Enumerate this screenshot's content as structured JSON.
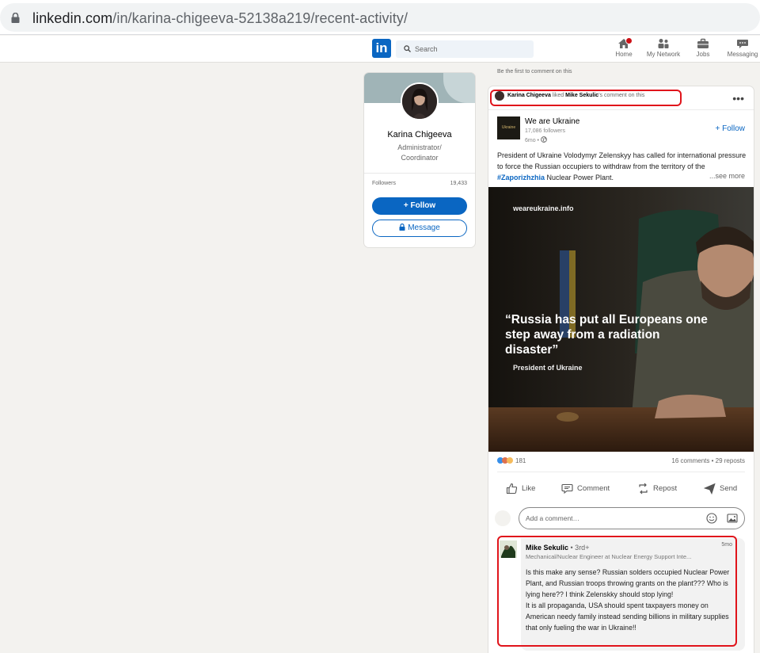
{
  "browser": {
    "url_host": "linkedin.com",
    "url_path": "/in/karina-chigeeva-52138a219/recent-activity/"
  },
  "nav": {
    "search_placeholder": "Search",
    "items": [
      {
        "label": "Home",
        "icon": "home-icon"
      },
      {
        "label": "My Network",
        "icon": "network-icon"
      },
      {
        "label": "Jobs",
        "icon": "briefcase-icon"
      },
      {
        "label": "Messaging",
        "icon": "messaging-icon"
      }
    ],
    "logo_text": "in"
  },
  "profile": {
    "name": "Karina Chigeeva",
    "title": "Administrator/ Coordinator",
    "followers_label": "Followers",
    "followers_count": "19,433",
    "follow_label": "+ Follow",
    "message_label": "Message"
  },
  "feed": {
    "first_comment_note": "Be the first to comment on this"
  },
  "post": {
    "actor_name": "Karina Chigeeva",
    "actor_action": " liked ",
    "actor_target": "Mike Sekulic",
    "actor_suffix": "'s comment on this",
    "org_name": "We are Ukraine",
    "org_logo_text": "Ukraine",
    "org_followers": "17,086 followers",
    "org_time": "6mo •",
    "follow_label": "+ Follow",
    "text_before_hashtag": "President of Ukraine Volodymyr Zelenskyy has called for international pressure to force the Russian occupiers to withdraw from the territory of the ",
    "hashtag": "#Zaporizhzhia",
    "text_after_hashtag": " Nuclear Power Plant.",
    "see_more": "...see more",
    "image_source": "weareukraine.info",
    "image_quote": "“Russia has put all Europeans one step away from a radiation disaster”",
    "image_caption": "President of Ukraine",
    "reactions_count": "181",
    "comments_reposts": "16 comments • 29 reposts",
    "actions": [
      "Like",
      "Comment",
      "Repost",
      "Send"
    ],
    "add_comment_placeholder": "Add a comment…"
  },
  "comment": {
    "author": "Mike Sekulic",
    "degree": " • 3rd+",
    "time": "5mo",
    "headline": "Mechanical/Nuclear Engineer at Nuclear Energy Support Inte...",
    "text": "Is this make any sense? Russian solders occupied Nuclear Power Plant, and Russian troops throwing grants on the plant??? Who is lying here?? I think Zelenskky should stop lying!\nIt is all propaganda, USA should spent taxpayers money on American needy family instead sending billions in military supplies that only fueling the war in Ukraine!!"
  },
  "colors": {
    "linkedin_blue": "#0a66c2",
    "highlight_red": "#e0141b",
    "page_bg": "#f3f2ef"
  }
}
